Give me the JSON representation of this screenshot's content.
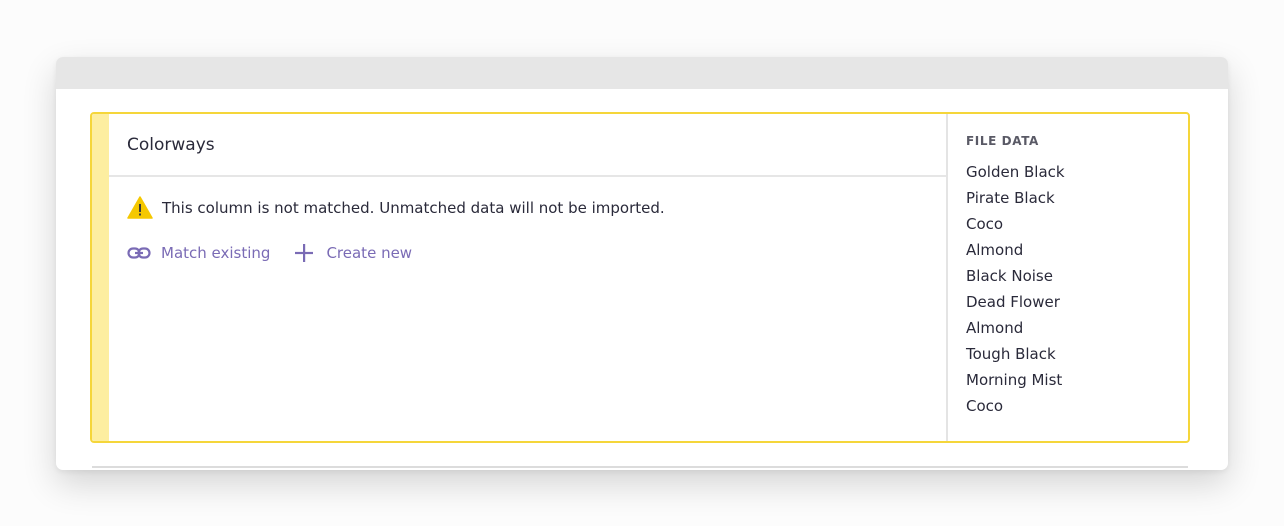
{
  "column": {
    "title": "Colorways",
    "warning_text": "This column is not matched. Unmatched data will not be imported.",
    "match_existing_label": "Match existing",
    "create_new_label": "Create new"
  },
  "file_data": {
    "heading": "FILE DATA",
    "items": [
      "Golden Black",
      "Pirate Black",
      "Coco",
      "Almond",
      "Black Noise",
      "Dead Flower",
      "Almond",
      "Tough Black",
      "Morning Mist",
      "Coco"
    ]
  },
  "colors": {
    "accent": "#7a6bb5",
    "warning": "#f5d63a",
    "stripe": "#fdeea0"
  }
}
